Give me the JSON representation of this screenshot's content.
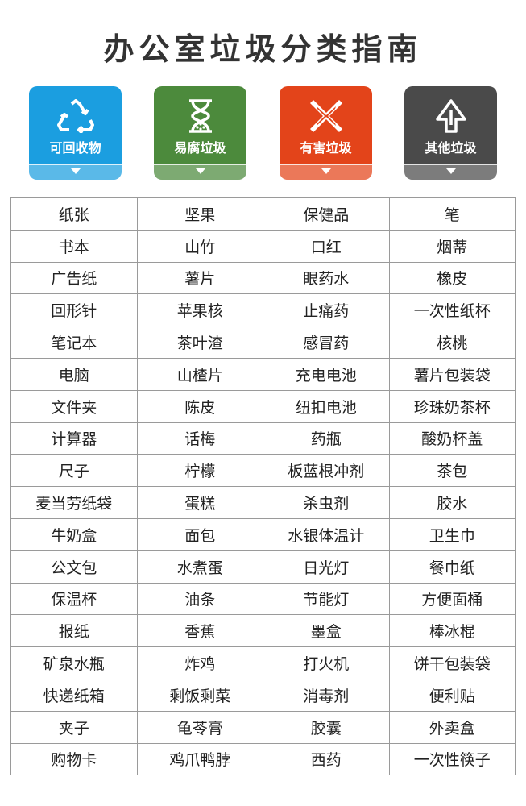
{
  "title": "办公室垃圾分类指南",
  "categories": [
    {
      "label": "可回收物",
      "color": "#1b9ee0",
      "icon": "recycle-icon"
    },
    {
      "label": "易腐垃圾",
      "color": "#4c8a3c",
      "icon": "hourglass-icon"
    },
    {
      "label": "有害垃圾",
      "color": "#e3441a",
      "icon": "hazard-cross-icon"
    },
    {
      "label": "其他垃圾",
      "color": "#4a4a4a",
      "icon": "other-waste-icon"
    }
  ],
  "rows": [
    [
      "纸张",
      "坚果",
      "保健品",
      "笔"
    ],
    [
      "书本",
      "山竹",
      "口红",
      "烟蒂"
    ],
    [
      "广告纸",
      "薯片",
      "眼药水",
      "橡皮"
    ],
    [
      "回形针",
      "苹果核",
      "止痛药",
      "一次性纸杯"
    ],
    [
      "笔记本",
      "茶叶渣",
      "感冒药",
      "核桃"
    ],
    [
      "电脑",
      "山楂片",
      "充电电池",
      "薯片包装袋"
    ],
    [
      "文件夹",
      "陈皮",
      "纽扣电池",
      "珍珠奶茶杯"
    ],
    [
      "计算器",
      "话梅",
      "药瓶",
      "酸奶杯盖"
    ],
    [
      "尺子",
      "柠檬",
      "板蓝根冲剂",
      "茶包"
    ],
    [
      "麦当劳纸袋",
      "蛋糕",
      "杀虫剂",
      "胶水"
    ],
    [
      "牛奶盒",
      "面包",
      "水银体温计",
      "卫生巾"
    ],
    [
      "公文包",
      "水煮蛋",
      "日光灯",
      "餐巾纸"
    ],
    [
      "保温杯",
      "油条",
      "节能灯",
      "方便面桶"
    ],
    [
      "报纸",
      "香蕉",
      "墨盒",
      "棒冰棍"
    ],
    [
      "矿泉水瓶",
      "炸鸡",
      "打火机",
      "饼干包装袋"
    ],
    [
      "快递纸箱",
      "剩饭剩菜",
      "消毒剂",
      "便利贴"
    ],
    [
      "夹子",
      "龟苓膏",
      "胶囊",
      "外卖盒"
    ],
    [
      "购物卡",
      "鸡爪鸭脖",
      "西药",
      "一次性筷子"
    ]
  ]
}
